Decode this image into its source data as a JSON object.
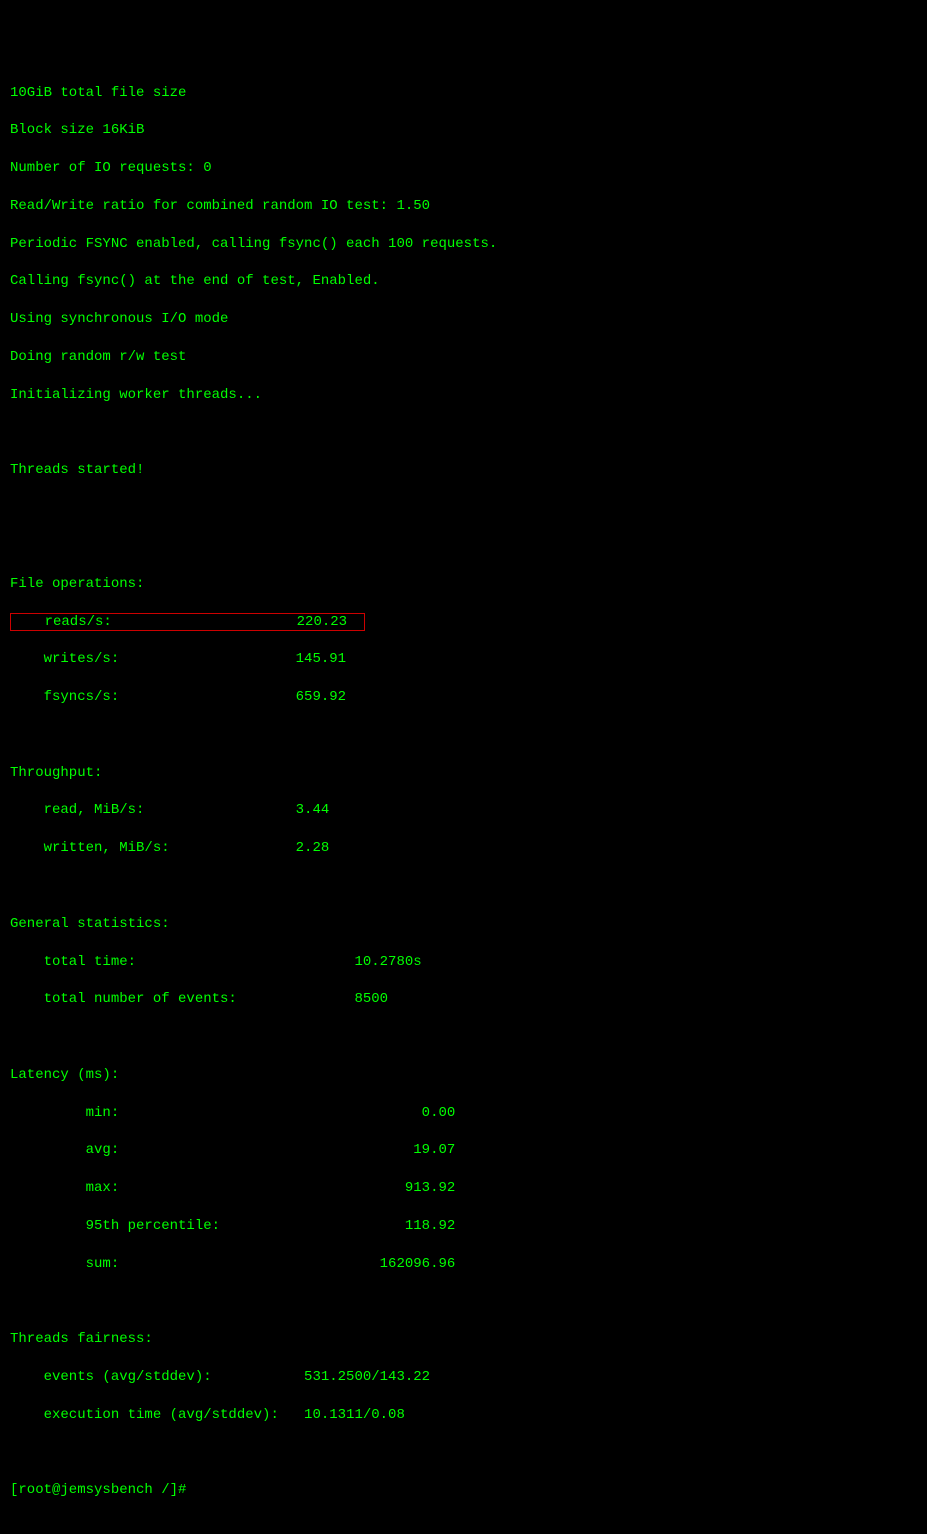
{
  "header": {
    "total_file_size": "10GiB total file size",
    "block_size": "Block size 16KiB",
    "io_requests": "Number of IO requests: 0",
    "rw_ratio": "Read/Write ratio for combined random IO test: 1.50",
    "fsync_periodic": "Periodic FSYNC enabled, calling fsync() each 100 requests.",
    "fsync_end": "Calling fsync() at the end of test, Enabled.",
    "io_mode": "Using synchronous I/O mode",
    "test_type": "Doing random r/w test",
    "init_workers": "Initializing worker threads...",
    "threads_started": "Threads started!"
  },
  "file_operations": {
    "title": "File operations:",
    "reads_label": "    reads/s:                      220.23  ",
    "writes_label": "    writes/s:                     145.91",
    "fsyncs_label": "    fsyncs/s:                     659.92"
  },
  "throughput": {
    "title": "Throughput:",
    "read": "    read, MiB/s:                  3.44",
    "written": "    written, MiB/s:               2.28"
  },
  "general_stats": {
    "title": "General statistics:",
    "total_time": "    total time:                          10.2780s",
    "total_events": "    total number of events:              8500"
  },
  "latency": {
    "title": "Latency (ms):",
    "min": "         min:                                    0.00",
    "avg": "         avg:                                   19.07",
    "max": "         max:                                  913.92",
    "percentile": "         95th percentile:                      118.92",
    "sum": "         sum:                               162096.96"
  },
  "threads_fairness": {
    "title": "Threads fairness:",
    "events": "    events (avg/stddev):           531.2500/143.22",
    "exec_time": "    execution time (avg/stddev):   10.1311/0.08"
  },
  "prompt": "[root@jemsysbench /]# "
}
